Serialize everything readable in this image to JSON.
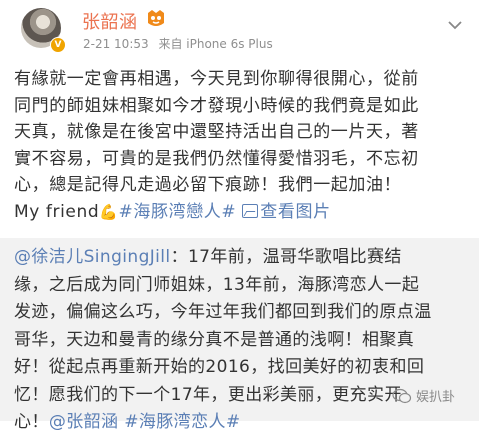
{
  "post": {
    "username": "张韶涵",
    "time": "2-21 10:53",
    "source": "来自 iPhone 6s Plus",
    "lines": [
      "有緣就一定會再相遇，今天見到你聊得很開心，從前",
      "同門的師姐妹相聚如今才發現小時候的我們竟是如此",
      "天真，就像是在後宮中還堅持活出自己的一片天，著",
      "實不容易，可貴的是我們仍然懂得愛惜羽毛，不忘初",
      "心，總是記得凡走過必留下痕跡！我們一起加油！"
    ],
    "last_line_prefix": "My friend",
    "topic": "#海豚湾戀人#",
    "view_pic": "查看图片"
  },
  "repost": {
    "mention_user": "@徐洁儿SingingJill",
    "lines": [
      "：17年前，温哥华歌唱比赛结",
      "缘，之后成为同门师姐妹，13年前，海豚湾恋人一起",
      "发迹，偏偏这么巧，今年过年我们都回到我们的原点温",
      "哥华，天边和曼青的缘分真不是普通的浅啊！相聚真",
      "好！從起点再重新开始的2016，找回美好的初衷和回",
      "忆！愿我们的下一个17年，更出彩美丽，更充实开",
      "心！"
    ],
    "mention_tail": "@张韶涵",
    "topic": "#海豚湾恋人#"
  },
  "watermark": "娱扒卦",
  "icons": {
    "avatar": "avatar",
    "verified": "verified-badge-icon",
    "vip": "vip-badge-icon",
    "menu": "chevron-down-icon",
    "flex": "flexed-arm-icon",
    "picture": "picture-icon",
    "wechat": "wechat-logo-icon"
  },
  "colors": {
    "username": "#eb7350",
    "link": "#5b7fb5",
    "repost_bg": "#f2f2f2"
  }
}
